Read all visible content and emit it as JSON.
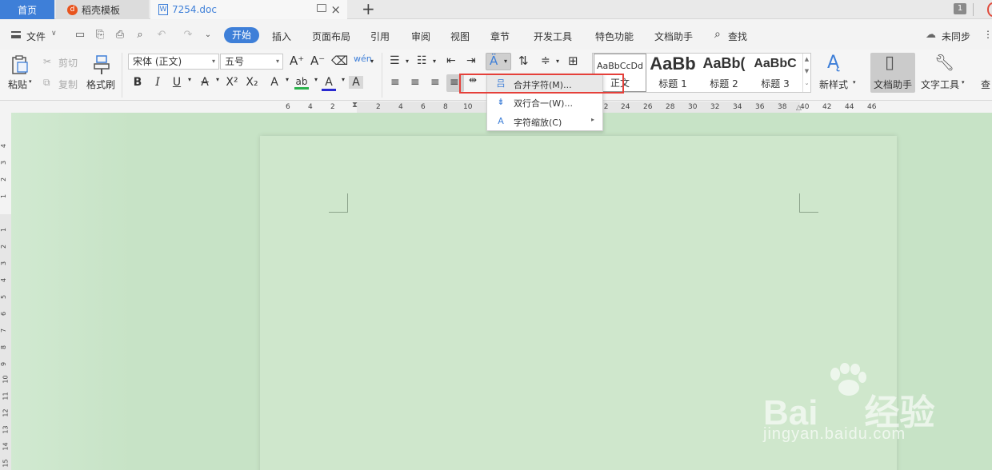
{
  "tabs": {
    "home": "首页",
    "template": "稻壳模板",
    "document": "7254.doc",
    "window_badge": "1"
  },
  "menu": {
    "file": "文件",
    "start": "开始",
    "items": [
      "插入",
      "页面布局",
      "引用",
      "审阅",
      "视图",
      "章节",
      "开发工具",
      "特色功能",
      "文档助手"
    ],
    "search": "查找",
    "sync": "未同步"
  },
  "ribbon": {
    "paste": "粘贴",
    "cut": "剪切",
    "copy": "复制",
    "format_painter": "格式刷",
    "font_name": "宋体 (正文)",
    "font_size": "五号",
    "styles": [
      {
        "preview": "AaBbCcDd",
        "name": "正文"
      },
      {
        "preview": "AaBb",
        "name": "标题 1"
      },
      {
        "preview": "AaBb(",
        "name": "标题 2"
      },
      {
        "preview": "AaBbC",
        "name": "标题 3"
      }
    ],
    "new_style": "新样式",
    "doc_assistant": "文档助手",
    "text_tools": "文字工具"
  },
  "ruler": {
    "h_ticks": [
      "6",
      "4",
      "2",
      "2",
      "4",
      "6",
      "8",
      "10",
      "22",
      "24",
      "26",
      "28",
      "30",
      "32",
      "34",
      "36",
      "38",
      "40",
      "42",
      "44",
      "46"
    ],
    "v_ticks": [
      "4",
      "3",
      "2",
      "1",
      "1",
      "2",
      "3",
      "4",
      "5",
      "6",
      "7",
      "8",
      "9",
      "10",
      "11",
      "12",
      "13",
      "14",
      "15"
    ]
  },
  "dropdown": {
    "items": [
      {
        "label": "合并字符(M)...",
        "icon": "merge-chars-icon"
      },
      {
        "label": "双行合一(W)...",
        "icon": "two-lines-icon"
      },
      {
        "label": "字符缩放(C)",
        "icon": "char-scale-icon"
      }
    ]
  },
  "watermark": {
    "brand": "Bai",
    "brand_cn": "经验",
    "url": "jingyan.baidu.com"
  },
  "colors": {
    "accent": "#3e7fd8",
    "canvas": "#c7e3c6",
    "highlight_box": "#e5403a"
  }
}
